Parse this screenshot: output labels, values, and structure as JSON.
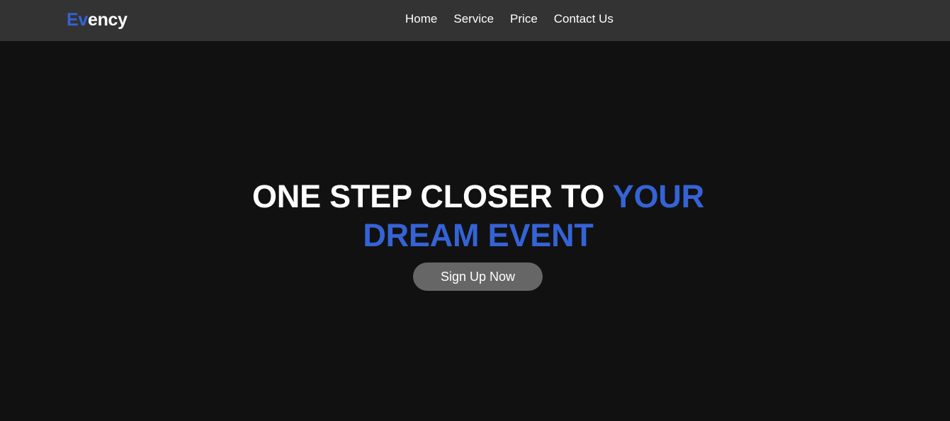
{
  "header": {
    "logo_accent": "Ev",
    "logo_rest": "ency",
    "nav": [
      {
        "label": "Home"
      },
      {
        "label": "Service"
      },
      {
        "label": "Price"
      },
      {
        "label": "Contact Us"
      }
    ]
  },
  "hero": {
    "headline_plain": "ONE STEP CLOSER TO ",
    "headline_accent": "YOUR DREAM EVENT",
    "cta_label": "Sign Up Now"
  },
  "colors": {
    "accent": "#3563d6",
    "navbar_bg": "#333333",
    "page_bg": "#111111",
    "button_bg": "#666666",
    "text": "#ffffff"
  }
}
